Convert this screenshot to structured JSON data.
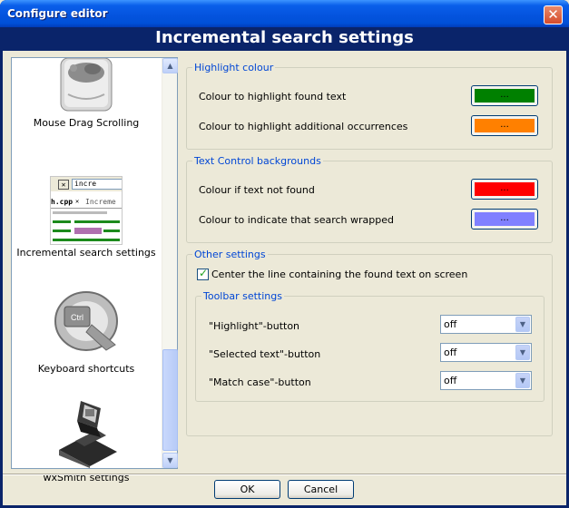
{
  "window": {
    "title": "Configure editor",
    "close_glyph": "✕"
  },
  "banner": {
    "title": "Incremental search settings"
  },
  "sidebar": {
    "items": [
      {
        "label": "Mouse Drag Scrolling",
        "icon": "mouse-icon"
      },
      {
        "label": "Incremental search settings",
        "icon": "incremental-search-preview",
        "preview_tab1": "h.cpp",
        "preview_tab2": "Increme",
        "preview_search": "incre"
      },
      {
        "label": "Keyboard shortcuts",
        "icon": "keyboard-shortcuts-icon",
        "key_text": "Ctrl"
      },
      {
        "label": "wxSmith settings",
        "icon": "wxsmith-icon"
      }
    ]
  },
  "highlight": {
    "legend": "Highlight colour",
    "found_label": "Colour to highlight found text",
    "found_color": "#008000",
    "occurrences_label": "Colour to highlight additional occurrences",
    "occurrences_color": "#FF8000",
    "button_text": "..."
  },
  "backgrounds": {
    "legend": "Text Control backgrounds",
    "not_found_label": "Colour if text not found",
    "not_found_color": "#FF0000",
    "wrapped_label": "Colour to indicate that search wrapped",
    "wrapped_color": "#8080FF",
    "button_text": "..."
  },
  "other": {
    "legend": "Other settings",
    "center_label": "Center the line containing the found text on screen",
    "center_checked": true,
    "toolbar": {
      "legend": "Toolbar settings",
      "rows": [
        {
          "label": "\"Highlight\"-button",
          "value": "off"
        },
        {
          "label": "\"Selected text\"-button",
          "value": "off"
        },
        {
          "label": "\"Match case\"-button",
          "value": "off"
        }
      ]
    }
  },
  "buttons": {
    "ok": "OK",
    "cancel": "Cancel"
  }
}
